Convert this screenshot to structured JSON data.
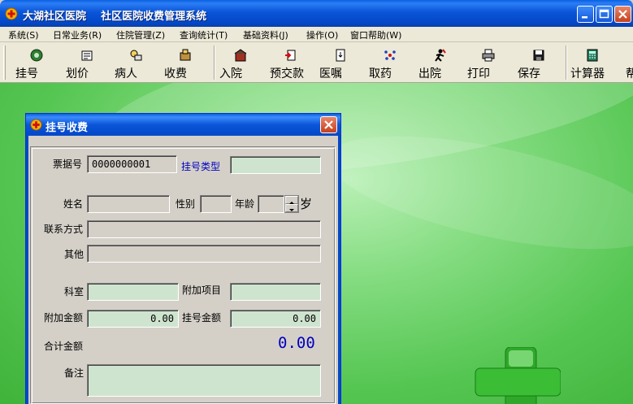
{
  "window": {
    "title": "大湖社区医院    社区医院收费管理系统"
  },
  "menu": [
    "系统(S)",
    "日常业务(R)",
    "住院管理(Z)",
    "查询统计(T)",
    "基础资料(J)",
    "操作(O)",
    "窗口帮助(W)"
  ],
  "toolbar": [
    {
      "label": "挂号",
      "icon": "register-icon"
    },
    {
      "label": "划价",
      "icon": "pricing-icon"
    },
    {
      "label": "病人",
      "icon": "patient-icon"
    },
    {
      "label": "收费",
      "icon": "charge-icon"
    },
    {
      "label": "入院",
      "icon": "admission-icon"
    },
    {
      "label": "预交款",
      "icon": "prepayment-icon"
    },
    {
      "label": "医嘱",
      "icon": "medical-order-icon"
    },
    {
      "label": "取药",
      "icon": "dispense-medicine-icon"
    },
    {
      "label": "出院",
      "icon": "discharge-icon"
    },
    {
      "label": "打印",
      "icon": "printer-icon"
    },
    {
      "label": "保存",
      "icon": "save-icon"
    },
    {
      "label": "计算器",
      "icon": "calculator-icon"
    }
  ],
  "dialog": {
    "title": "挂号收费",
    "labels": {
      "receipt_no": "票据号",
      "reg_type": "挂号类型",
      "name": "姓名",
      "gender": "性别",
      "age": "年龄",
      "age_unit": "岁",
      "contact": "联系方式",
      "other": "其他",
      "department": "科室",
      "extra_item": "附加项目",
      "extra_amount": "附加金额",
      "reg_amount": "挂号金额",
      "total": "合计金额",
      "remark": "备注"
    },
    "values": {
      "receipt_no": "0000000001",
      "reg_type": "",
      "name": "",
      "gender": "",
      "age": "",
      "contact": "",
      "other": "",
      "department": "",
      "extra_item": "",
      "extra_amount": "0.00",
      "reg_amount": "0.00",
      "total": "0.00",
      "remark": ""
    }
  },
  "colors": {
    "titlebar": "#0348c8",
    "label_blue": "#0000c0",
    "field_green": "#cfe4cf",
    "desktop_green": "#56c653"
  }
}
